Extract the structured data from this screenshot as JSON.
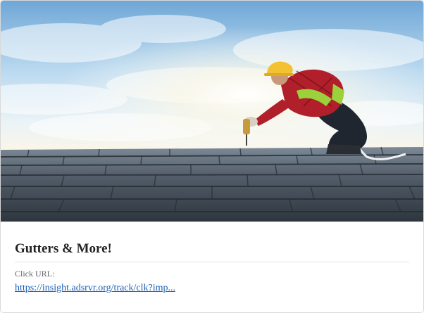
{
  "ad": {
    "title": "Gutters & More!",
    "click_url_label": "Click URL:",
    "click_url": "https://insight.adsrvr.org/track/clk?imp..."
  },
  "hero": {
    "icon": "roofer-photo",
    "colors": {
      "sky": "#c8e2f4",
      "roof": "#3e4650",
      "shirt": "#b01f2a",
      "helmet": "#f2c233",
      "vest": "#9bd13a"
    }
  }
}
